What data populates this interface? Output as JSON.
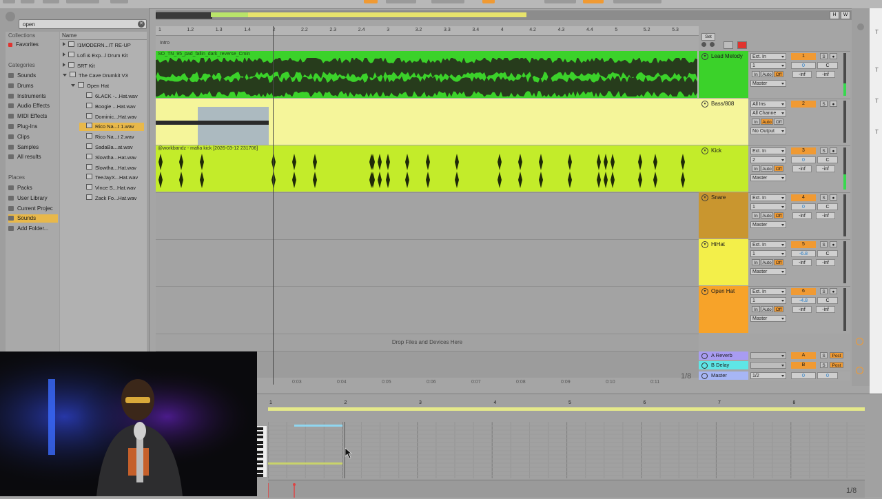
{
  "browser": {
    "search_value": "open",
    "sections": {
      "collections": "Collections",
      "categories": "Categories",
      "places": "Places"
    },
    "collections": [
      "Favorites"
    ],
    "categories": [
      "Sounds",
      "Drums",
      "Instruments",
      "Audio Effects",
      "MIDI Effects",
      "Plug-Ins",
      "Clips",
      "Samples",
      "All results"
    ],
    "places": [
      "Packs",
      "User Library",
      "Current Projec",
      "Sounds",
      "Add Folder..."
    ],
    "column_header": "Name",
    "files": [
      {
        "label": "!1MODERN...IT RE-UP",
        "kind": "folder",
        "indent": 0
      },
      {
        "label": "Lofi & Exp...l Drum Kit",
        "kind": "folder",
        "indent": 0
      },
      {
        "label": "SRT Kit",
        "kind": "folder",
        "indent": 0
      },
      {
        "label": "The Cave Drumkit V3",
        "kind": "folder-open",
        "indent": 0
      },
      {
        "label": "Open Hat",
        "kind": "folder-open",
        "indent": 1
      },
      {
        "label": "6LACK -...Hat.wav",
        "kind": "file",
        "indent": 2
      },
      {
        "label": "Boogie ...Hat.wav",
        "kind": "file",
        "indent": 2
      },
      {
        "label": "Dominic...Hat.wav",
        "kind": "file",
        "indent": 2
      },
      {
        "label": "Rico Na...t 1.wav",
        "kind": "file",
        "indent": 2,
        "selected": true
      },
      {
        "label": "Rico Na...t 2.wav",
        "kind": "file",
        "indent": 2
      },
      {
        "label": "SadaBa...at.wav",
        "kind": "file",
        "indent": 2
      },
      {
        "label": "Slowtha...Hat.wav",
        "kind": "file",
        "indent": 2
      },
      {
        "label": "Slowtha...Hat.wav",
        "kind": "file",
        "indent": 2
      },
      {
        "label": "TeeJayX...Hat.wav",
        "kind": "file",
        "indent": 2
      },
      {
        "label": "Vince S...Hat.wav",
        "kind": "file",
        "indent": 2
      },
      {
        "label": "Zack Fo...Hat.wav",
        "kind": "file",
        "indent": 2
      }
    ]
  },
  "arrangement": {
    "ruler": [
      "1",
      "1.2",
      "1.3",
      "1.4",
      "2",
      "2.2",
      "2.3",
      "2.4",
      "3",
      "3.2",
      "3.3",
      "3.4",
      "4",
      "4.2",
      "4.3",
      "4.4",
      "5",
      "5.2",
      "5.3"
    ],
    "locator": "Intro",
    "set_button": "Set",
    "drop_text": "Drop Files and Devices Here",
    "time_ruler": [
      "0:03",
      "0:04",
      "0:05",
      "0:06",
      "0:07",
      "0:08",
      "0:09",
      "0:10",
      "0:11"
    ],
    "grid_fraction": "1/8",
    "clips": {
      "lead": "SO_TN_95_pad_fallin_dark_reverse_Cmin",
      "kick": "@workbandz - mafia kick [2026-03-12 231706]"
    }
  },
  "tracks": [
    {
      "name": "Lead Melody",
      "color": "#3bd22a",
      "input": "Ext. In",
      "channel": "1",
      "monitor": [
        "In",
        "Auto",
        "Off"
      ],
      "output": "Master",
      "number": "1",
      "volume": "0",
      "pan": "C",
      "sends": [
        "-inf",
        "-inf"
      ]
    },
    {
      "name": "Bass/808",
      "color": "#f5f59a",
      "input": "All Ins",
      "channel": "All Channe",
      "monitor": [
        "In",
        "Auto",
        "Off"
      ],
      "output": "No Output",
      "number": "2",
      "volume": "",
      "pan": "",
      "sends": []
    },
    {
      "name": "Kick",
      "color": "#c3ec2a",
      "input": "Ext. In",
      "channel": "2",
      "monitor": [
        "In",
        "Auto",
        "Off"
      ],
      "output": "Master",
      "number": "3",
      "volume": "0",
      "pan": "C",
      "sends": [
        "-inf",
        "-inf"
      ]
    },
    {
      "name": "Snare",
      "color": "#c9962f",
      "input": "Ext. In",
      "channel": "1",
      "monitor": [
        "In",
        "Auto",
        "Off"
      ],
      "output": "Master",
      "number": "4",
      "volume": "0",
      "pan": "C",
      "sends": [
        "-inf",
        "-inf"
      ]
    },
    {
      "name": "HiHat",
      "color": "#f3ef4a",
      "input": "Ext. In",
      "channel": "1",
      "monitor": [
        "In",
        "Auto",
        "Off"
      ],
      "output": "Master",
      "number": "5",
      "volume": "-6.8",
      "pan": "C",
      "sends": [
        "-inf",
        "-inf"
      ]
    },
    {
      "name": "Open Hat",
      "color": "#f7a329",
      "input": "Ext. In",
      "channel": "1",
      "monitor": [
        "In",
        "Auto",
        "Off"
      ],
      "output": "Master",
      "number": "6",
      "volume": "-4.8",
      "pan": "C",
      "sends": [
        "-inf",
        "-inf"
      ]
    }
  ],
  "returns": [
    {
      "name": "A Reverb",
      "color": "#a89cf2",
      "letter": "A",
      "post": "Post"
    },
    {
      "name": "B Delay",
      "color": "#5ee6e6",
      "letter": "B",
      "post": "Post"
    },
    {
      "name": "Master",
      "color": "#a7b6f5",
      "letter": "",
      "post": "",
      "cue": "1/2",
      "volume": "0",
      "pan": "0"
    }
  ],
  "clip_view": {
    "ruler": [
      "1",
      "2",
      "3",
      "4",
      "5",
      "6",
      "7",
      "8"
    ],
    "grid_fraction": "1/8"
  }
}
